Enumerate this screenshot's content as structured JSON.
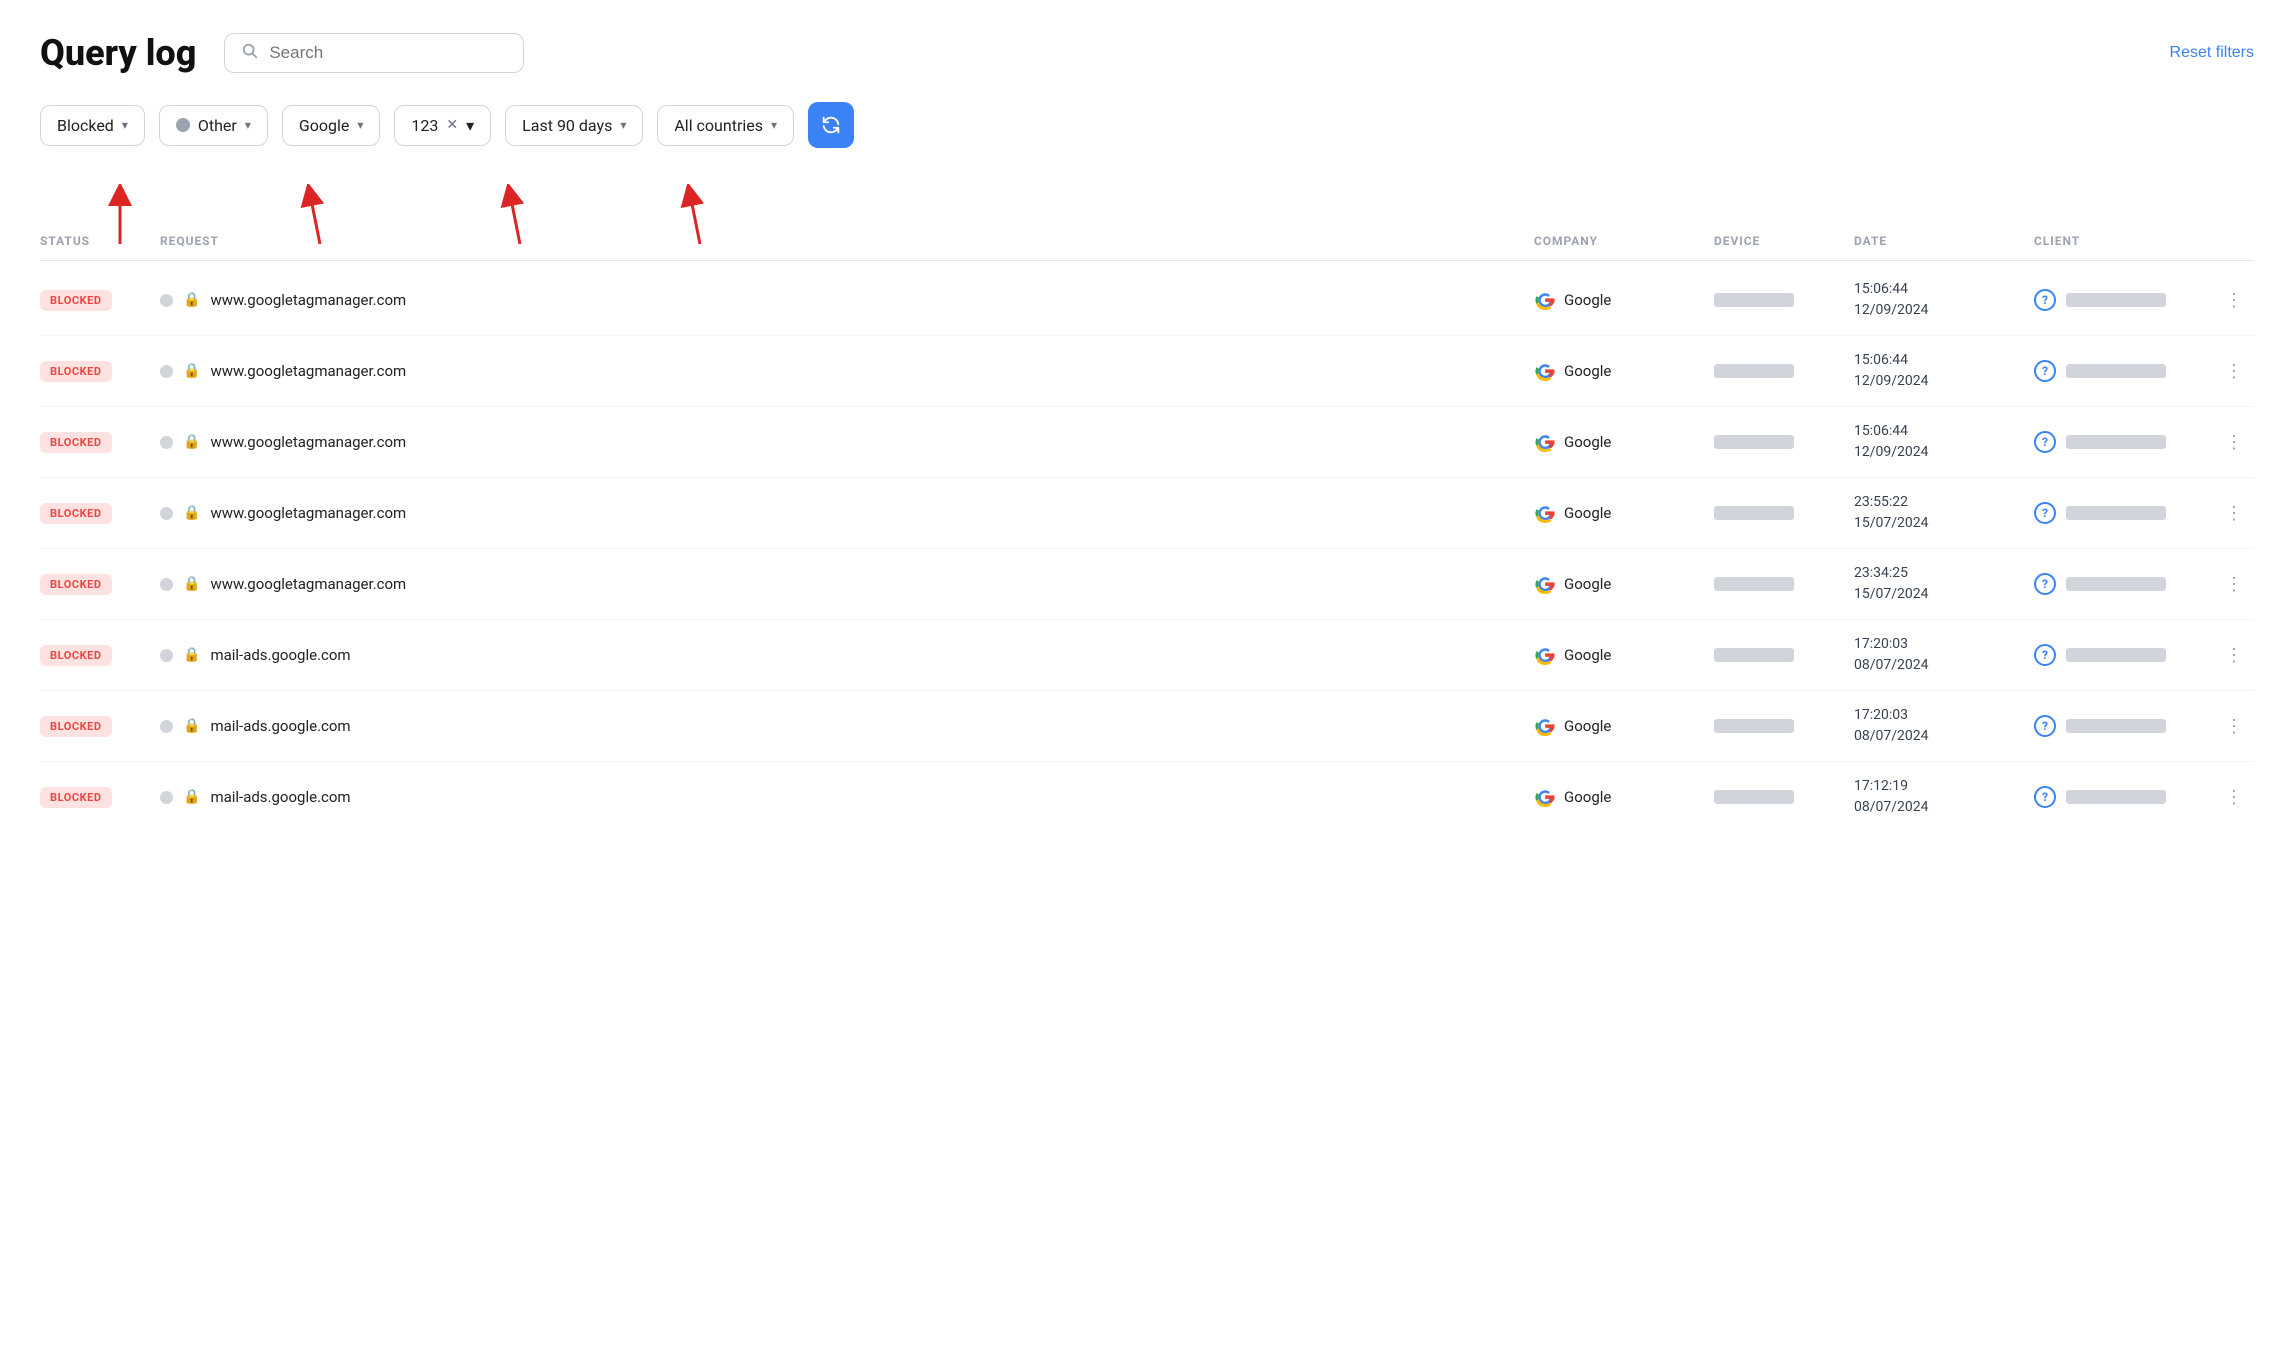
{
  "page": {
    "title": "Query log",
    "reset_filters_label": "Reset filters",
    "search_placeholder": "Search"
  },
  "filters": {
    "status": {
      "label": "Blocked",
      "type": "dropdown"
    },
    "type": {
      "label": "Other",
      "type": "dropdown",
      "has_dot": true
    },
    "company": {
      "label": "Google",
      "type": "dropdown"
    },
    "search_id": {
      "label": "123",
      "type": "clearable"
    },
    "time": {
      "label": "Last 90 days",
      "type": "dropdown"
    },
    "country": {
      "label": "All countries",
      "type": "dropdown"
    }
  },
  "columns": [
    "STATUS",
    "REQUEST",
    "COMPANY",
    "DEVICE",
    "DATE",
    "CLIENT",
    ""
  ],
  "rows": [
    {
      "status": "BLOCKED",
      "request": "www.googletagmanager.com",
      "company": "Google",
      "date": "15:06:44\n12/09/2024"
    },
    {
      "status": "BLOCKED",
      "request": "www.googletagmanager.com",
      "company": "Google",
      "date": "15:06:44\n12/09/2024"
    },
    {
      "status": "BLOCKED",
      "request": "www.googletagmanager.com",
      "company": "Google",
      "date": "15:06:44\n12/09/2024"
    },
    {
      "status": "BLOCKED",
      "request": "www.googletagmanager.com",
      "company": "Google",
      "date": "23:55:22\n15/07/2024"
    },
    {
      "status": "BLOCKED",
      "request": "www.googletagmanager.com",
      "company": "Google",
      "date": "23:34:25\n15/07/2024"
    },
    {
      "status": "BLOCKED",
      "request": "mail-ads.google.com",
      "company": "Google",
      "date": "17:20:03\n08/07/2024"
    },
    {
      "status": "BLOCKED",
      "request": "mail-ads.google.com",
      "company": "Google",
      "date": "17:20:03\n08/07/2024"
    },
    {
      "status": "BLOCKED",
      "request": "mail-ads.google.com",
      "company": "Google",
      "date": "17:12:19\n08/07/2024"
    }
  ],
  "icons": {
    "search": "🔍",
    "chevron_down": "▾",
    "refresh": "↻",
    "lock": "🔒",
    "more": "⋮",
    "question": "?"
  }
}
